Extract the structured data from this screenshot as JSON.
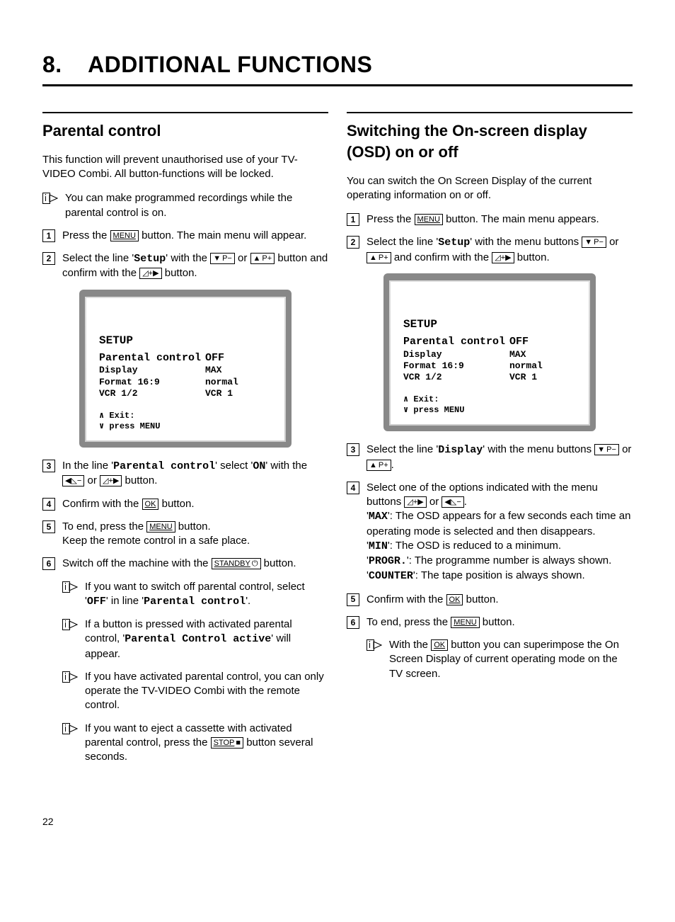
{
  "chapter": {
    "number": "8.",
    "title": "ADDITIONAL FUNCTIONS"
  },
  "buttons": {
    "menu": "MENU",
    "ok": "OK",
    "standby": "STANDBY",
    "stop": "STOP",
    "p_minus": "P−",
    "p_plus": "P+"
  },
  "left": {
    "heading": "Parental control",
    "intro": "This function will prevent unauthorised use of your TV-VIDEO Combi. All button-functions will be locked.",
    "tip0": "You can make programmed recordings while the parental control is on.",
    "step1a": "Press the ",
    "step1b": " button. The main menu will appear.",
    "step2a": "Select the line '",
    "step2_setup": "Setup",
    "step2b": "' with the ",
    "step2c": " or ",
    "step2d": " button and confirm with the ",
    "step2e": " button.",
    "screen": {
      "title": "SETUP",
      "rows": [
        {
          "l": "Parental control",
          "r": "OFF"
        },
        {
          "l": "Display",
          "r": "MAX"
        },
        {
          "l": "Format 16:9",
          "r": "normal"
        },
        {
          "l": "VCR 1/2",
          "r": "VCR 1"
        }
      ],
      "foot1": "∧ Exit:",
      "foot2": "∨ press MENU"
    },
    "step3a": "In the line '",
    "step3_pc": "Parental control",
    "step3b": "' select '",
    "step3_on": "ON",
    "step3c": "' with the ",
    "step3d": " or ",
    "step3e": " button.",
    "step4a": "Confirm with the ",
    "step4b": " button.",
    "step5a": "To end, press the ",
    "step5b": " button.",
    "step5c": "Keep the remote control in a safe place.",
    "step6a": "Switch off the machine with the ",
    "step6b": " button.",
    "tip_off_a": "If you want to switch off parental control, select '",
    "tip_off_off": "OFF",
    "tip_off_b": "' in line '",
    "tip_off_pc": "Parental control",
    "tip_off_c": "'.",
    "tip_active_a": "If a button is pressed with activated parental control, '",
    "tip_active_msg": "Parental Control active",
    "tip_active_b": "' will appear.",
    "tip_remote": "If you have activated parental control, you can only operate the TV-VIDEO Combi with the remote control.",
    "tip_eject_a": "If you want to eject a cassette with activated parental control, press the ",
    "tip_eject_b": " button several seconds."
  },
  "right": {
    "heading": "Switching the On-screen display (OSD) on or off",
    "intro": "You can switch the On Screen Display of the current operating information on or off.",
    "step1a": "Press the ",
    "step1b": " button. The main menu appears.",
    "step2a": "Select the line '",
    "step2_setup": "Setup",
    "step2b": "' with the menu buttons ",
    "step2c": " or ",
    "step2d": " and confirm with the ",
    "step2e": " button.",
    "screen": {
      "title": "SETUP",
      "rows": [
        {
          "l": "Parental control",
          "r": "OFF"
        },
        {
          "l": "Display",
          "r": "MAX"
        },
        {
          "l": "Format 16:9",
          "r": "normal"
        },
        {
          "l": "VCR 1/2",
          "r": "VCR 1"
        }
      ],
      "foot1": "∧ Exit:",
      "foot2": "∨ press MENU"
    },
    "step3a": "Select the line '",
    "step3_disp": "Display",
    "step3b": "' with the menu buttons ",
    "step3c": " or ",
    "step3d": ".",
    "step4a": "Select one of the options indicated with the menu buttons ",
    "step4b": " or ",
    "step4c": ".",
    "opt_max_lbl": "MAX",
    "opt_max_txt": "': The OSD appears for a few seconds each time an operating mode is selected and then disappears.",
    "opt_min_lbl": "MIN",
    "opt_min_txt": "': The OSD is reduced to a minimum.",
    "opt_progr_lbl": "PROGR.",
    "opt_progr_txt": "': The programme number is always shown.",
    "opt_counter_lbl": "COUNTER",
    "opt_counter_txt": "': The tape position is always shown.",
    "step5a": "Confirm with the ",
    "step5b": " button.",
    "step6a": "To end, press the ",
    "step6b": " button.",
    "tip_ok_a": "With the ",
    "tip_ok_b": " button you can superimpose the On Screen Display of current operating mode on the TV screen."
  },
  "page_number": "22"
}
